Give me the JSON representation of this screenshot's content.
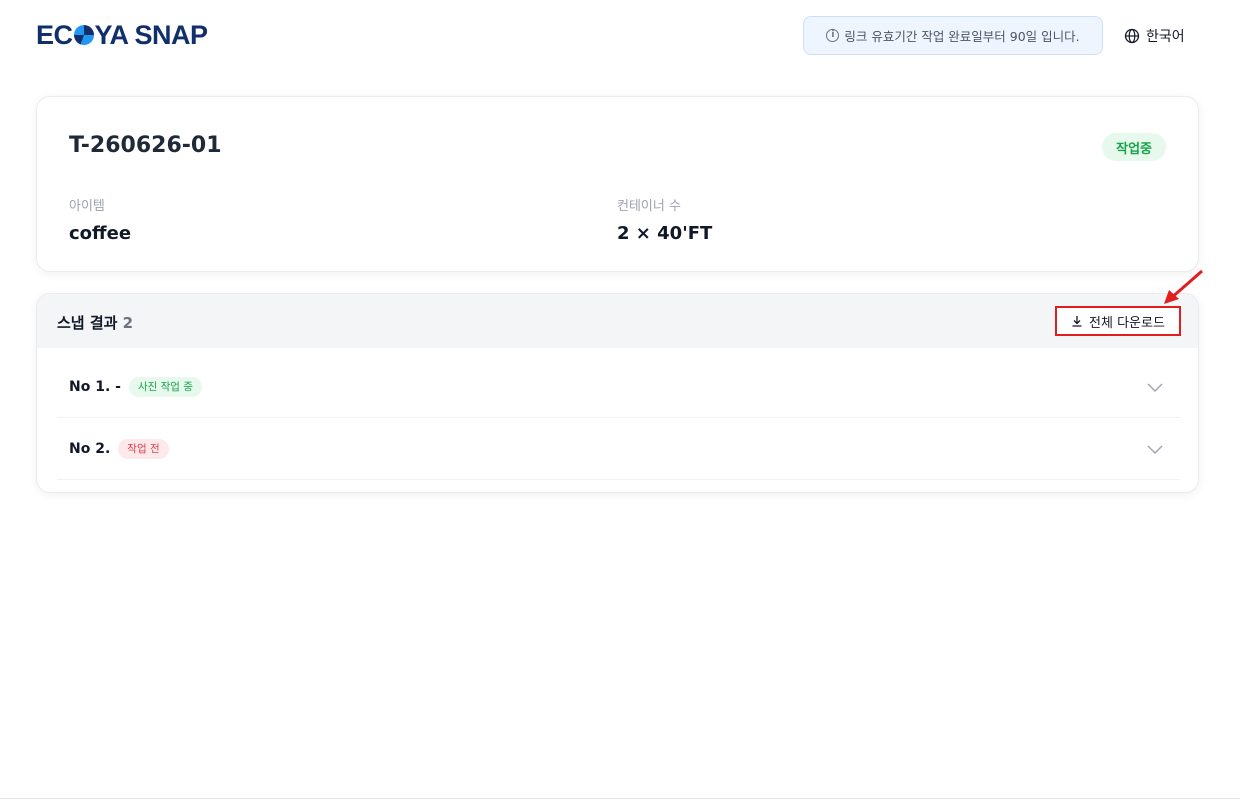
{
  "header": {
    "logo_left": "EC",
    "logo_right": "YA SNAP",
    "notice_icon": "info-icon",
    "notice": "링크 유효기간 작업 완료일부터 90일 입니다.",
    "language_icon": "globe-icon",
    "language": "한국어"
  },
  "job": {
    "id": "T-260626-01",
    "status": "작업중",
    "item_label": "아이템",
    "item_value": "coffee",
    "container_label": "컨테이너 수",
    "container_value": "2 × 40'FT"
  },
  "results": {
    "title": "스냅 결과",
    "count": "2",
    "download_icon": "download-icon",
    "download_label": "전체 다운로드",
    "rows": [
      {
        "no": "No 1. -",
        "badge": "사진 작업 중",
        "badge_color": "#16a34a"
      },
      {
        "no": "No 2.",
        "badge": "작업 전",
        "badge_color": "#e23b4b"
      }
    ]
  },
  "colors": {
    "annotation": "#e11d1d",
    "brand_dark": "#11306b",
    "brand_blue": "#1877ff"
  }
}
